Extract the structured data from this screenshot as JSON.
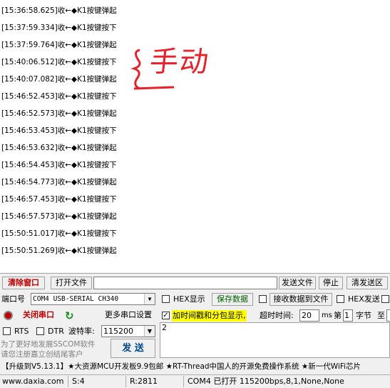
{
  "log": [
    "[15:36:58.625]收←◆K1按键弹起",
    "[15:37:59.334]收←◆K1按键按下",
    "[15:37:59.764]收←◆K1按键弹起",
    "[15:40:06.512]收←◆K1按键按下",
    "[15:40:07.082]收←◆K1按键弹起",
    "[15:46:52.453]收←◆K1按键按下",
    "[15:46:52.573]收←◆K1按键弹起",
    "[15:46:53.453]收←◆K1按键按下",
    "[15:46:53.632]收←◆K1按键弹起",
    "[15:46:54.453]收←◆K1按键按下",
    "[15:46:54.773]收←◆K1按键弹起",
    "[15:46:57.453]收←◆K1按键按下",
    "[15:46:57.573]收←◆K1按键弹起",
    "[15:50:51.017]收←◆K1按键按下",
    "[15:50:51.269]收←◆K1按键弹起"
  ],
  "annotation": "手动",
  "toolbar": {
    "clear": "清除窗口",
    "open_file": "打开文件",
    "send_file": "发送文件",
    "stop": "停止",
    "clear_send": "清发送区"
  },
  "port": {
    "label": "端口号",
    "value": "COM4 USB-SERIAL CH340",
    "close": "关闭串口",
    "more": "更多串口设置",
    "rts": "RTS",
    "dtr": "DTR",
    "baud_label": "波特率:",
    "baud_value": "115200"
  },
  "options": {
    "hex_display": "HEX显示",
    "save_data": "保存数据",
    "recv_to_file": "接收数据到文件",
    "hex_send": "HEX发送",
    "timestamp": "加时间戳和分包显示,",
    "timeout_label": "超时时间:",
    "timeout_value": "20",
    "timeout_unit": "ms",
    "frame_label": "第",
    "frame_value": "1",
    "byte_label": "字节",
    "to_label": "至"
  },
  "send_box": "2",
  "promo": "为了更好地发展SSCOM软件\n请您注册嘉立创结尾客户",
  "send_button": "发 送",
  "ticker": "【升级到V5.13.1】★大资源MCU开发板9.9包邮 ★RT-Thread中国人的开源免费操作系统 ★新一代WiFi芯片",
  "status": {
    "site": "www.daxia.com",
    "s": "S:4",
    "r": "R:2811",
    "port": "COM4 已打开  115200bps,8,1,None,None"
  },
  "colors": {
    "annotation": "#e8202a",
    "clear_red": "#c00000",
    "timestamp_bg": "#ffff00",
    "save_green": "#006000"
  }
}
